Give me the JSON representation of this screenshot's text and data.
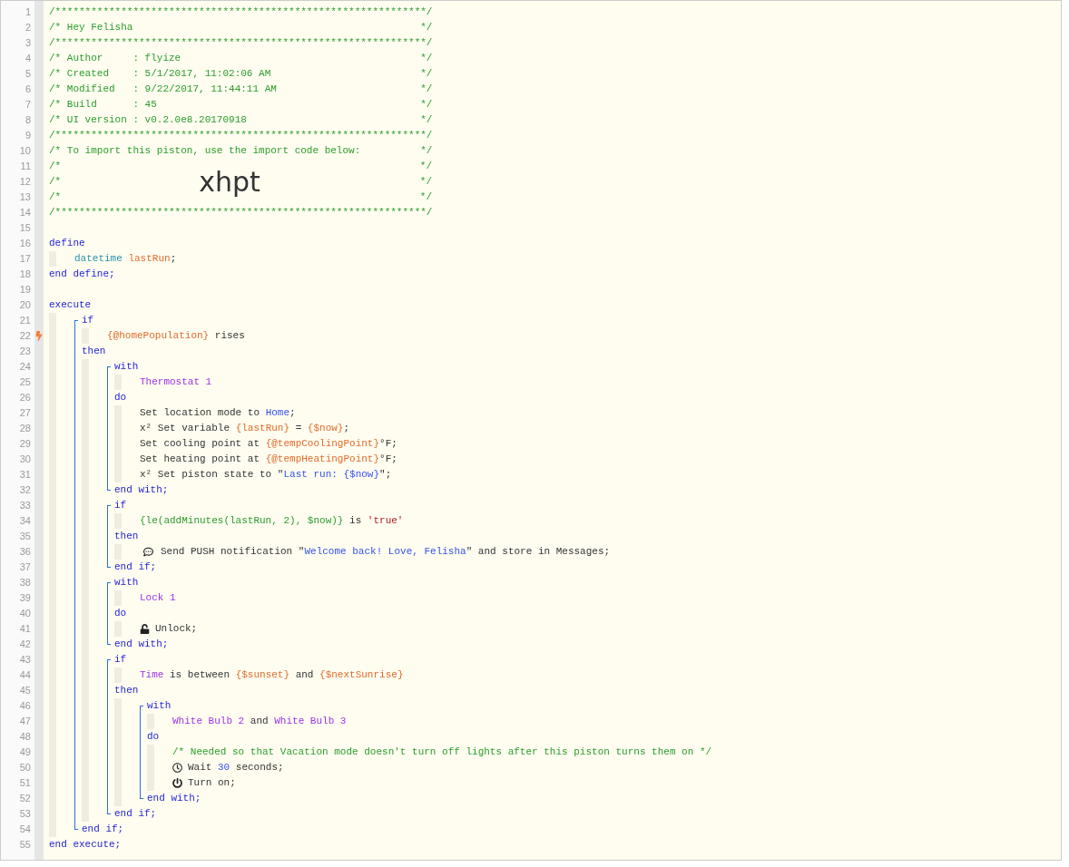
{
  "editor": {
    "items": [
      {
        "kind": "line",
        "number": "1",
        "trigger": false,
        "tokens": [
          {
            "kind": "comment",
            "text": "/**************************************************************/"
          }
        ]
      },
      {
        "kind": "line",
        "number": "2",
        "trigger": false,
        "tokens": [
          {
            "kind": "comment",
            "text": "/* Hey Felisha                                                */"
          }
        ]
      },
      {
        "kind": "line",
        "number": "3",
        "trigger": false,
        "tokens": [
          {
            "kind": "comment",
            "text": "/**************************************************************/"
          }
        ]
      },
      {
        "kind": "line",
        "number": "4",
        "trigger": false,
        "tokens": [
          {
            "kind": "comment",
            "text": "/* Author     : flyize                                        */"
          }
        ]
      },
      {
        "kind": "line",
        "number": "5",
        "trigger": false,
        "tokens": [
          {
            "kind": "comment",
            "text": "/* Created    : 5/1/2017, 11:02:06 AM                         */"
          }
        ]
      },
      {
        "kind": "line",
        "number": "6",
        "trigger": false,
        "tokens": [
          {
            "kind": "comment",
            "text": "/* Modified   : 9/22/2017, 11:44:11 AM                        */"
          }
        ]
      },
      {
        "kind": "line",
        "number": "7",
        "trigger": false,
        "tokens": [
          {
            "kind": "comment",
            "text": "/* Build      : 45                                            */"
          }
        ]
      },
      {
        "kind": "line",
        "number": "8",
        "trigger": false,
        "tokens": [
          {
            "kind": "comment",
            "text": "/* UI version : v0.2.0e8.20170918                             */"
          }
        ]
      },
      {
        "kind": "line",
        "number": "9",
        "trigger": false,
        "tokens": [
          {
            "kind": "comment",
            "text": "/**************************************************************/"
          }
        ]
      },
      {
        "kind": "line",
        "number": "10",
        "trigger": false,
        "tokens": [
          {
            "kind": "comment",
            "text": "/* To import this piston, use the import code below:          */"
          }
        ]
      },
      {
        "kind": "line",
        "number": "11",
        "trigger": false,
        "tokens": [
          {
            "kind": "comment",
            "text": "/*"
          },
          {
            "kind": "comment_end",
            "text": "*/"
          }
        ]
      },
      {
        "kind": "line",
        "number": "12",
        "trigger": false,
        "tokens": [
          {
            "kind": "comment",
            "text": "/*"
          },
          {
            "kind": "import_code",
            "text": "xhpt"
          },
          {
            "kind": "comment_end",
            "text": "*/"
          }
        ]
      },
      {
        "kind": "line",
        "number": "13",
        "trigger": false,
        "tokens": [
          {
            "kind": "comment",
            "text": "/*"
          },
          {
            "kind": "comment_end",
            "text": "*/"
          }
        ]
      },
      {
        "kind": "line",
        "number": "14",
        "trigger": false,
        "tokens": [
          {
            "kind": "comment",
            "text": "/**************************************************************/"
          }
        ]
      },
      {
        "kind": "line",
        "number": "15",
        "trigger": false
      },
      {
        "kind": "statement",
        "bracket": false,
        "parts": [
          {
            "line": {
              "number": "16",
              "trigger": false,
              "tokens": [
                {
                  "kind": "keyword",
                  "text": "define"
                }
              ]
            },
            "children": [
              {
                "kind": "line",
                "number": "17",
                "trigger": false,
                "tokens": [
                  {
                    "kind": "type",
                    "text": "datetime "
                  },
                  {
                    "kind": "variable",
                    "text": "lastRun"
                  },
                  {
                    "kind": "plain",
                    "text": ";"
                  }
                ]
              }
            ]
          },
          {
            "line": {
              "number": "18",
              "trigger": false,
              "tokens": [
                {
                  "kind": "keyword",
                  "text": "end define;"
                }
              ]
            }
          }
        ]
      },
      {
        "kind": "line",
        "number": "19",
        "trigger": false
      },
      {
        "kind": "statement",
        "bracket": false,
        "parts": [
          {
            "line": {
              "number": "20",
              "trigger": false,
              "tokens": [
                {
                  "kind": "keyword",
                  "text": "execute"
                }
              ]
            },
            "children": [
              {
                "kind": "statement",
                "bracket": true,
                "parts": [
                  {
                    "line": {
                      "number": "21",
                      "trigger": false,
                      "tokens": [
                        {
                          "kind": "keyword",
                          "text": "if"
                        }
                      ]
                    },
                    "children": [
                      {
                        "kind": "line",
                        "number": "22",
                        "trigger": true,
                        "tokens": [
                          {
                            "kind": "variable",
                            "text": "{@homePopulation}"
                          },
                          {
                            "kind": "plain",
                            "text": " rises"
                          }
                        ]
                      }
                    ]
                  },
                  {
                    "line": {
                      "number": "23",
                      "trigger": false,
                      "tokens": [
                        {
                          "kind": "keyword",
                          "text": "then"
                        }
                      ]
                    },
                    "children": [
                      {
                        "kind": "statement",
                        "bracket": true,
                        "parts": [
                          {
                            "line": {
                              "number": "24",
                              "trigger": false,
                              "tokens": [
                                {
                                  "kind": "keyword",
                                  "text": "with"
                                }
                              ]
                            },
                            "children": [
                              {
                                "kind": "line",
                                "number": "25",
                                "trigger": false,
                                "tokens": [
                                  {
                                    "kind": "device",
                                    "text": "Thermostat 1"
                                  }
                                ]
                              }
                            ]
                          },
                          {
                            "line": {
                              "number": "26",
                              "trigger": false,
                              "tokens": [
                                {
                                  "kind": "keyword",
                                  "text": "do"
                                }
                              ]
                            },
                            "children": [
                              {
                                "kind": "line",
                                "number": "27",
                                "trigger": false,
                                "tokens": [
                                  {
                                    "kind": "plain",
                                    "text": "Set location mode to "
                                  },
                                  {
                                    "kind": "value",
                                    "text": "Home"
                                  },
                                  {
                                    "kind": "plain",
                                    "text": ";"
                                  }
                                ]
                              },
                              {
                                "kind": "line",
                                "number": "28",
                                "trigger": false,
                                "tokens": [
                                  {
                                    "kind": "plain",
                                    "text": "x² Set variable "
                                  },
                                  {
                                    "kind": "variable",
                                    "text": "{lastRun}"
                                  },
                                  {
                                    "kind": "plain",
                                    "text": " = "
                                  },
                                  {
                                    "kind": "variable",
                                    "text": "{$now}"
                                  },
                                  {
                                    "kind": "plain",
                                    "text": ";"
                                  }
                                ]
                              },
                              {
                                "kind": "line",
                                "number": "29",
                                "trigger": false,
                                "tokens": [
                                  {
                                    "kind": "plain",
                                    "text": "Set cooling point at "
                                  },
                                  {
                                    "kind": "variable",
                                    "text": "{@tempCoolingPoint}"
                                  },
                                  {
                                    "kind": "plain",
                                    "text": "°F;"
                                  }
                                ]
                              },
                              {
                                "kind": "line",
                                "number": "30",
                                "trigger": false,
                                "tokens": [
                                  {
                                    "kind": "plain",
                                    "text": "Set heating point at "
                                  },
                                  {
                                    "kind": "variable",
                                    "text": "{@tempHeatingPoint}"
                                  },
                                  {
                                    "kind": "plain",
                                    "text": "°F;"
                                  }
                                ]
                              },
                              {
                                "kind": "line",
                                "number": "31",
                                "trigger": false,
                                "tokens": [
                                  {
                                    "kind": "plain",
                                    "text": "x² Set piston state to \""
                                  },
                                  {
                                    "kind": "value",
                                    "text": "Last run: {$now}"
                                  },
                                  {
                                    "kind": "plain",
                                    "text": "\";"
                                  }
                                ]
                              }
                            ]
                          },
                          {
                            "line": {
                              "number": "32",
                              "trigger": false,
                              "tokens": [
                                {
                                  "kind": "keyword",
                                  "text": "end with;"
                                }
                              ]
                            }
                          }
                        ]
                      },
                      {
                        "kind": "statement",
                        "bracket": true,
                        "parts": [
                          {
                            "line": {
                              "number": "33",
                              "trigger": false,
                              "tokens": [
                                {
                                  "kind": "keyword",
                                  "text": "if"
                                }
                              ]
                            },
                            "children": [
                              {
                                "kind": "line",
                                "number": "34",
                                "trigger": false,
                                "tokens": [
                                  {
                                    "kind": "expression",
                                    "text": "{le(addMinutes(lastRun, 2), $now)}"
                                  },
                                  {
                                    "kind": "plain",
                                    "text": " is "
                                  },
                                  {
                                    "kind": "literal",
                                    "text": "'true'"
                                  }
                                ]
                              }
                            ]
                          },
                          {
                            "line": {
                              "number": "35",
                              "trigger": false,
                              "tokens": [
                                {
                                  "kind": "keyword",
                                  "text": "then"
                                }
                              ]
                            },
                            "children": [
                              {
                                "kind": "line",
                                "number": "36",
                                "trigger": false,
                                "tokens": [
                                  {
                                    "kind": "icon_chat"
                                  },
                                  {
                                    "kind": "plain",
                                    "text": "Send PUSH notification \""
                                  },
                                  {
                                    "kind": "value",
                                    "text": "Welcome back! Love, Felisha"
                                  },
                                  {
                                    "kind": "plain",
                                    "text": "\" and store in Messages;"
                                  }
                                ]
                              }
                            ]
                          },
                          {
                            "line": {
                              "number": "37",
                              "trigger": false,
                              "tokens": [
                                {
                                  "kind": "keyword",
                                  "text": "end if;"
                                }
                              ]
                            }
                          }
                        ]
                      },
                      {
                        "kind": "statement",
                        "bracket": true,
                        "parts": [
                          {
                            "line": {
                              "number": "38",
                              "trigger": false,
                              "tokens": [
                                {
                                  "kind": "keyword",
                                  "text": "with"
                                }
                              ]
                            },
                            "children": [
                              {
                                "kind": "line",
                                "number": "39",
                                "trigger": false,
                                "tokens": [
                                  {
                                    "kind": "device",
                                    "text": "Lock 1"
                                  }
                                ]
                              }
                            ]
                          },
                          {
                            "line": {
                              "number": "40",
                              "trigger": false,
                              "tokens": [
                                {
                                  "kind": "keyword",
                                  "text": "do"
                                }
                              ]
                            },
                            "children": [
                              {
                                "kind": "line",
                                "number": "41",
                                "trigger": false,
                                "tokens": [
                                  {
                                    "kind": "icon_unlock"
                                  },
                                  {
                                    "kind": "plain",
                                    "text": "Unlock;"
                                  }
                                ]
                              }
                            ]
                          },
                          {
                            "line": {
                              "number": "42",
                              "trigger": false,
                              "tokens": [
                                {
                                  "kind": "keyword",
                                  "text": "end with;"
                                }
                              ]
                            }
                          }
                        ]
                      },
                      {
                        "kind": "statement",
                        "bracket": true,
                        "parts": [
                          {
                            "line": {
                              "number": "43",
                              "trigger": false,
                              "tokens": [
                                {
                                  "kind": "keyword",
                                  "text": "if"
                                }
                              ]
                            },
                            "children": [
                              {
                                "kind": "line",
                                "number": "44",
                                "trigger": false,
                                "tokens": [
                                  {
                                    "kind": "device",
                                    "text": "Time"
                                  },
                                  {
                                    "kind": "plain",
                                    "text": " is between "
                                  },
                                  {
                                    "kind": "variable",
                                    "text": "{$sunset}"
                                  },
                                  {
                                    "kind": "plain",
                                    "text": " and "
                                  },
                                  {
                                    "kind": "variable",
                                    "text": "{$nextSunrise}"
                                  }
                                ]
                              }
                            ]
                          },
                          {
                            "line": {
                              "number": "45",
                              "trigger": false,
                              "tokens": [
                                {
                                  "kind": "keyword",
                                  "text": "then"
                                }
                              ]
                            },
                            "children": [
                              {
                                "kind": "statement",
                                "bracket": true,
                                "parts": [
                                  {
                                    "line": {
                                      "number": "46",
                                      "trigger": false,
                                      "tokens": [
                                        {
                                          "kind": "keyword",
                                          "text": "with"
                                        }
                                      ]
                                    },
                                    "children": [
                                      {
                                        "kind": "line",
                                        "number": "47",
                                        "trigger": false,
                                        "tokens": [
                                          {
                                            "kind": "device",
                                            "text": "White Bulb 2"
                                          },
                                          {
                                            "kind": "plain",
                                            "text": " and "
                                          },
                                          {
                                            "kind": "device",
                                            "text": "White Bulb 3"
                                          }
                                        ]
                                      }
                                    ]
                                  },
                                  {
                                    "line": {
                                      "number": "48",
                                      "trigger": false,
                                      "tokens": [
                                        {
                                          "kind": "keyword",
                                          "text": "do"
                                        }
                                      ]
                                    },
                                    "children": [
                                      {
                                        "kind": "line",
                                        "number": "49",
                                        "trigger": false,
                                        "tokens": [
                                          {
                                            "kind": "comment",
                                            "text": "/* Needed so that Vacation mode doesn't turn off lights after this piston turns them on */"
                                          }
                                        ]
                                      },
                                      {
                                        "kind": "line",
                                        "number": "50",
                                        "trigger": false,
                                        "tokens": [
                                          {
                                            "kind": "icon_clock"
                                          },
                                          {
                                            "kind": "plain",
                                            "text": "Wait "
                                          },
                                          {
                                            "kind": "value",
                                            "text": "30"
                                          },
                                          {
                                            "kind": "plain",
                                            "text": " seconds;"
                                          }
                                        ]
                                      },
                                      {
                                        "kind": "line",
                                        "number": "51",
                                        "trigger": false,
                                        "tokens": [
                                          {
                                            "kind": "icon_power"
                                          },
                                          {
                                            "kind": "plain",
                                            "text": "Turn on;"
                                          }
                                        ]
                                      }
                                    ]
                                  },
                                  {
                                    "line": {
                                      "number": "52",
                                      "trigger": false,
                                      "tokens": [
                                        {
                                          "kind": "keyword",
                                          "text": "end with;"
                                        }
                                      ]
                                    }
                                  }
                                ]
                              }
                            ]
                          },
                          {
                            "line": {
                              "number": "53",
                              "trigger": false,
                              "tokens": [
                                {
                                  "kind": "keyword",
                                  "text": "end if;"
                                }
                              ]
                            }
                          }
                        ]
                      }
                    ]
                  },
                  {
                    "line": {
                      "number": "54",
                      "trigger": false,
                      "tokens": [
                        {
                          "kind": "keyword",
                          "text": "end if;"
                        }
                      ]
                    }
                  }
                ]
              }
            ]
          },
          {
            "line": {
              "number": "55",
              "trigger": false,
              "tokens": [
                {
                  "kind": "keyword",
                  "text": "end execute;"
                }
              ]
            }
          }
        ]
      }
    ]
  }
}
